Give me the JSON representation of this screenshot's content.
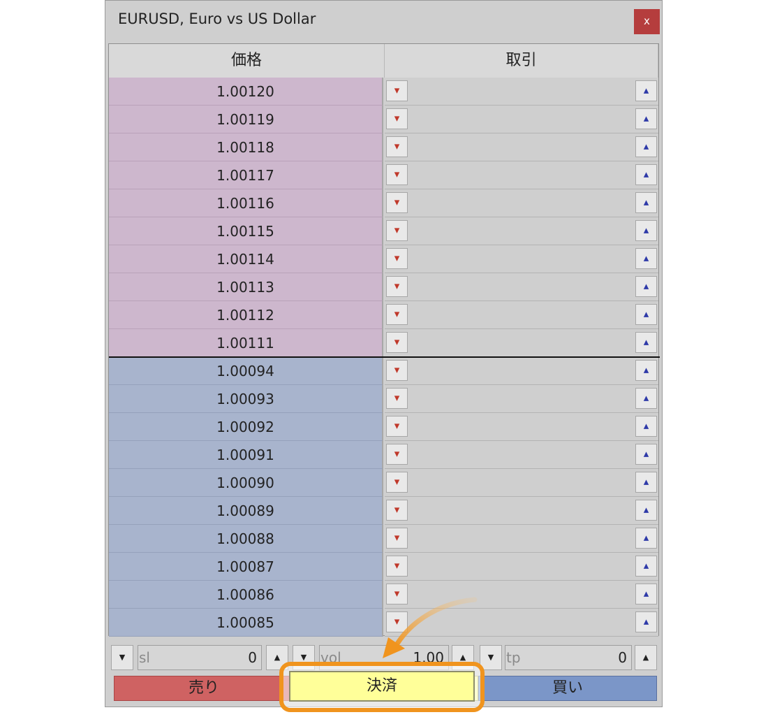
{
  "window": {
    "title": "EURUSD, Euro vs US Dollar",
    "close_label": "x"
  },
  "table": {
    "headers": {
      "price": "価格",
      "trade": "取引"
    },
    "ask_rows": [
      "1.00120",
      "1.00119",
      "1.00118",
      "1.00117",
      "1.00116",
      "1.00115",
      "1.00114",
      "1.00113",
      "1.00112",
      "1.00111"
    ],
    "bid_rows": [
      "1.00094",
      "1.00093",
      "1.00092",
      "1.00091",
      "1.00090",
      "1.00089",
      "1.00088",
      "1.00087",
      "1.00086",
      "1.00085"
    ],
    "sell_arrow_glyph": "▾",
    "buy_arrow_glyph": "▴"
  },
  "controls": {
    "sl": {
      "placeholder": "sl",
      "value": "0"
    },
    "vol": {
      "placeholder": "vol",
      "value": "1.00"
    },
    "tp": {
      "placeholder": "tp",
      "value": "0"
    },
    "down_glyph": "▼",
    "up_glyph": "▲"
  },
  "actions": {
    "sell": "売り",
    "close": "決済",
    "buy": "買い"
  },
  "colors": {
    "ask_bg": "#cdb7cd",
    "bid_bg": "#a8b4cd",
    "sell": "#cf6262",
    "close": "#ffff99",
    "buy": "#7b96c8",
    "highlight": "#f0941e"
  }
}
